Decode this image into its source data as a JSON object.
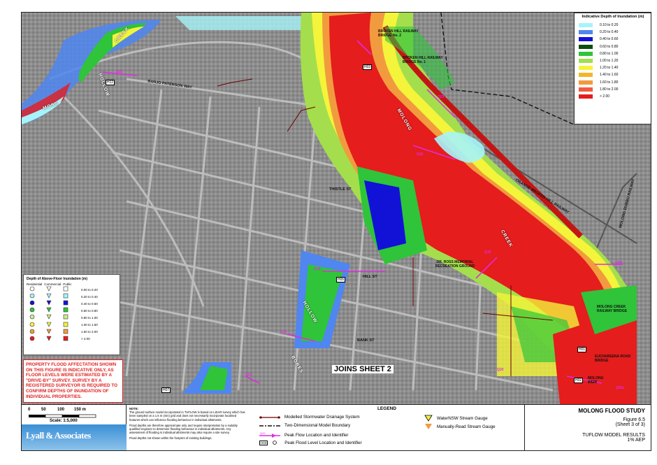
{
  "depth_legend": {
    "title": "Indicative Depth of Inundation (m)",
    "items": [
      {
        "label": "0.10 to 0.20",
        "color": "#a6f4f9"
      },
      {
        "label": "0.20 to 0.40",
        "color": "#4f86f0"
      },
      {
        "label": "0.40 to 0.60",
        "color": "#1212d6"
      },
      {
        "label": "0.60 to 0.80",
        "color": "#0b4f0e"
      },
      {
        "label": "0.80 to 1.00",
        "color": "#2fc43a"
      },
      {
        "label": "1.00 to 1.20",
        "color": "#a4de4c"
      },
      {
        "label": "1.20 to 1.40",
        "color": "#f4f43a"
      },
      {
        "label": "1.40 to 1.60",
        "color": "#f5b52b"
      },
      {
        "label": "1.60 to 1.80",
        "color": "#f29b3e"
      },
      {
        "label": "1.80 to 2.00",
        "color": "#f25b3d"
      },
      {
        "label": "> 2.00",
        "color": "#e51d1d"
      }
    ]
  },
  "floor_legend": {
    "title": "Depth of Above-Floor Inundation (m)",
    "headers": [
      "Residential",
      "Commercial",
      "Public"
    ],
    "rows": [
      {
        "label": "0.00 to 0.20",
        "color": "#ffffff"
      },
      {
        "label": "0.20 to 0.40",
        "color": "#a6f4f9"
      },
      {
        "label": "0.40 to 0.60",
        "color": "#1212d6"
      },
      {
        "label": "0.60 to 0.80",
        "color": "#2fc43a"
      },
      {
        "label": "0.80 to 1.00",
        "color": "#c9ef8a"
      },
      {
        "label": "1.00 to 1.50",
        "color": "#f4f43a"
      },
      {
        "label": "1.50 to 2.00",
        "color": "#f29b3e"
      },
      {
        "label": "> 2.00",
        "color": "#e51d1d"
      }
    ]
  },
  "warning": "PROPERTY FLOOD AFFECTATION SHOWN ON THIS FIGURE IS INDICATIVE ONLY, AS FLOOR LEVELS WERE ESTIMATED BY A \"DRIVE-BY\" SURVEY. SURVEY BY A REGISTERED SURVEYOR IS REQUIRED TO CONFIRM DEPTHS OF INUNDATION OF INDIVIDUAL PROPERTIES.",
  "joins_sheet": "JOINS SHEET 2",
  "map_labels": {
    "bh_bridge2": "BROKEN HILL RAILWAY BRIDGE No. 2",
    "bh_bridge1": "BROKEN HILL RAILWAY BRIDGE No. 1",
    "ross": "DR. ROSS MEMORIAL RECREATION GROUND",
    "molong_creek_rail": "MOLONG CREEK RAILWAY BRIDGE",
    "euchareena": "EUCHAREENA ROAD BRIDGE",
    "molong_weir": "MOLONG WEIR",
    "creek": "CREEK",
    "molong": "MOLONG",
    "hollow": "HOLLOW",
    "moss": "MOSS",
    "hollow2": "HOLLOW",
    "bores": "BORES",
    "creek2": "CREEK",
    "orange_bh_railway": "ORANGE BROKEN HILL RAILWAY",
    "molong_dubbo_railway": "MOLONG DUBBO RAILWAY",
    "bank_paterson": "BANJO PATERSON WAY",
    "thistle": "THISTLE ST",
    "hill": "HILL ST",
    "bank": "BANK ST",
    "q_labels": [
      "Q22",
      "Q23",
      "Q16",
      "Q17",
      "Q18",
      "Q21",
      "Q19",
      "Q20",
      "Q05a",
      "Q04"
    ],
    "h_labels": [
      "H12",
      "H03",
      "H05",
      "H07",
      "H02",
      "H01"
    ]
  },
  "scale": {
    "ticks": [
      "0",
      "50",
      "100",
      "150 m"
    ],
    "label": "Scale: 1:5,000"
  },
  "logo": "Lyall & Associates",
  "note": {
    "title": "NOTE:",
    "p1": "The ground surface model incorporated in TUFLOW is based on LiDAR survey which has been sampled on a 1.5 m (min) grid and does not necessarily incorporate localised features which can influence flooding behaviour in individual allotments.",
    "p2": "Flood depths are therefore approximate only and require interpretation by a suitably qualified engineer to determine flooding behaviour in individual allotments. Any assessment of flooding in individual allotments may also require a site survey.",
    "p3": "Flood depths not shown within the footprint of existing buildings."
  },
  "legend": {
    "title": "LEGEND",
    "items": [
      "Modelled Stormwater Drainage System",
      "Two-Dimensional Model Boundary",
      "Peak Flow Location and Identifier",
      "Peak Flood Level Location and Identifier",
      "WaterNSW Stream Gauge",
      "Manually-Read Stream Gauge"
    ],
    "peak_flow_id": "Q22",
    "peak_level_id": "H03"
  },
  "title_block": {
    "study": "MOLONG FLOOD STUDY",
    "figure": "Figure 6.5",
    "sheet": "(Sheet 3 of 3)",
    "results": "TUFLOW MODEL RESULTS",
    "aep": "1% AEP"
  }
}
